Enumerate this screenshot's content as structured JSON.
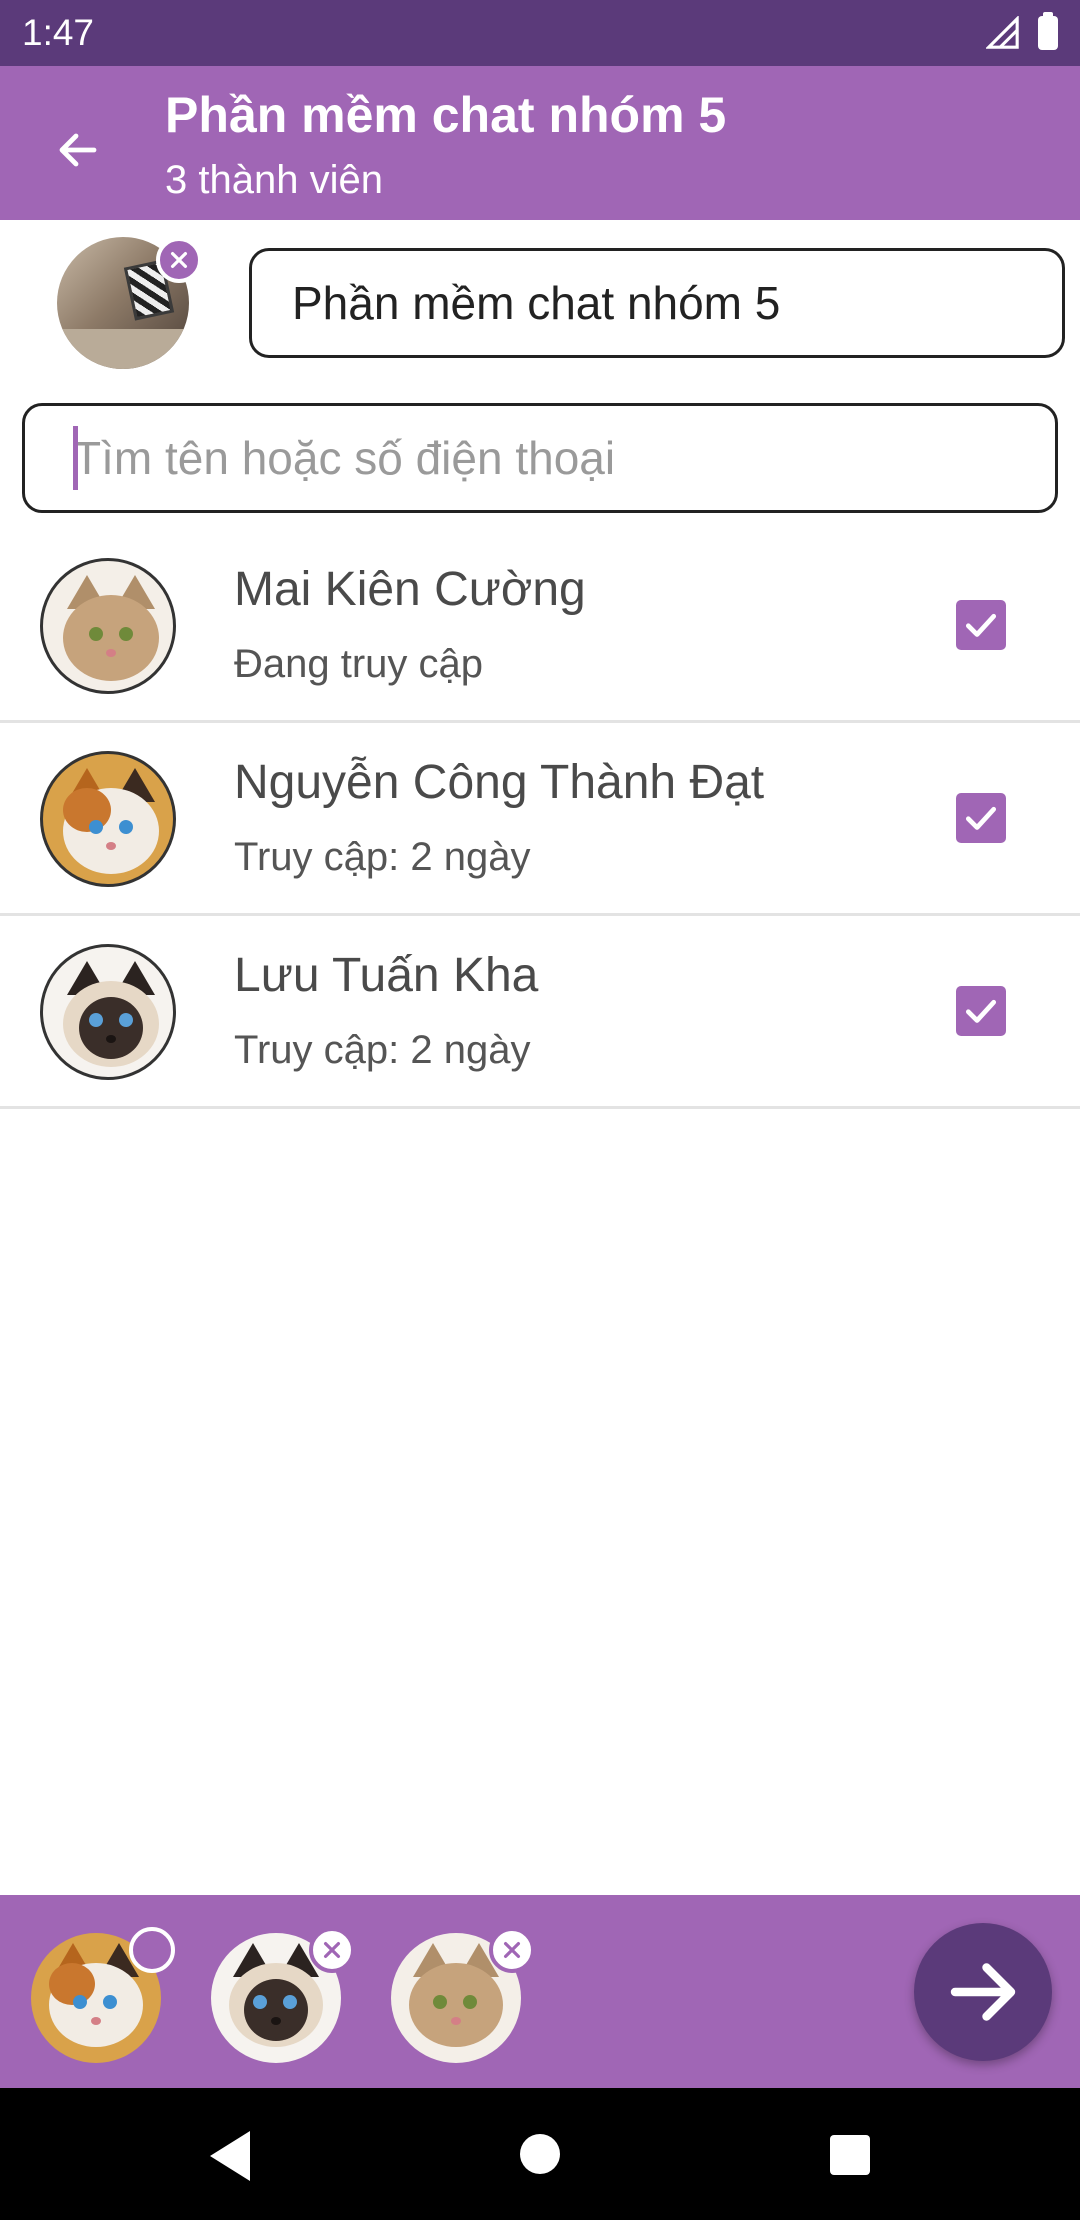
{
  "status_bar": {
    "time": "1:47"
  },
  "app_bar": {
    "title": "Phần mềm chat nhóm 5",
    "subtitle": "3 thành viên"
  },
  "group": {
    "name_value": "Phần mềm chat nhóm 5"
  },
  "search": {
    "placeholder": "Tìm tên hoặc số điện thoại"
  },
  "contacts": [
    {
      "name": "Mai Kiên Cường",
      "status": "Đang truy cập",
      "checked": true
    },
    {
      "name": "Nguyễn Công Thành Đạt",
      "status": "Truy cập: 2 ngày",
      "checked": true
    },
    {
      "name": "Lưu Tuấn Kha",
      "status": "Truy cập: 2 ngày",
      "checked": true
    }
  ],
  "icons": {
    "back": "arrow-left-icon",
    "remove": "close-icon",
    "check": "checkmark-icon",
    "next": "arrow-right-icon"
  },
  "colors": {
    "status_bar": "#5b3a7a",
    "app_bar": "#a066b5",
    "accent": "#a066b5",
    "next_button": "#5b3a7a"
  }
}
